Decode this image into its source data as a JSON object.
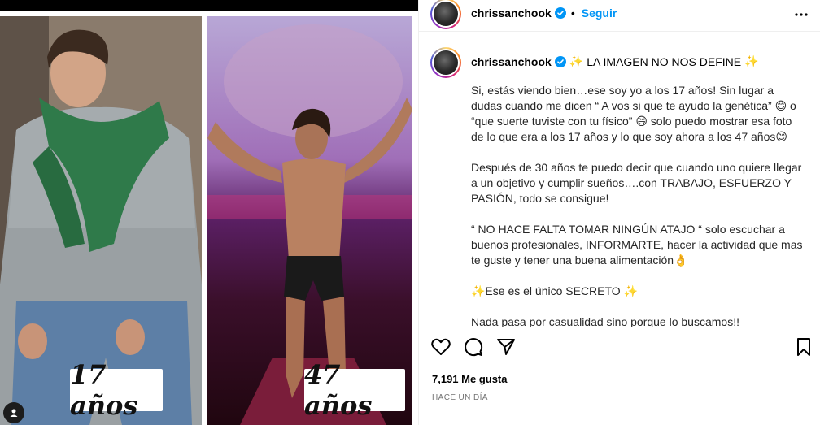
{
  "post": {
    "left_label": "17 años",
    "right_label": "47 años"
  },
  "header": {
    "username": "chrissanchook",
    "separator": "•",
    "follow_label": "Seguir"
  },
  "caption": {
    "username": "chrissanchook",
    "sparkle": "✨",
    "title": "LA IMAGEN NO NOS DEFINE",
    "paragraphs": [
      "Si, estás viendo bien…ese soy yo a los 17 años! Sin lugar a dudas cuando me dicen “ A vos si que te ayudo la genética” 😄 o “que suerte tuviste con tu físico” 😄 solo puedo mostrar esa foto de lo que era a los 17 años y lo que soy ahora a los 47 años😊",
      "Después de 30 años te puedo decir que cuando uno quiere llegar a un objetivo y cumplir sueños….con TRABAJO, ESFUERZO Y PASIÓN, todo se consigue!",
      "“ NO HACE FALTA TOMAR NINGÚN ATAJO “ solo escuchar a buenos profesionales, INFORMARTE, hacer la actividad que mas te guste y tener una buena alimentación👌",
      "✨Ese es el único SECRETO ✨",
      "Nada pasa por casualidad sino porque lo buscamos!!"
    ]
  },
  "stats": {
    "likes": "7,191 Me gusta",
    "time": "HACE UN DÍA"
  },
  "colors": {
    "link": "#0095f6",
    "verified": "#0095f6",
    "muted": "#737373"
  }
}
